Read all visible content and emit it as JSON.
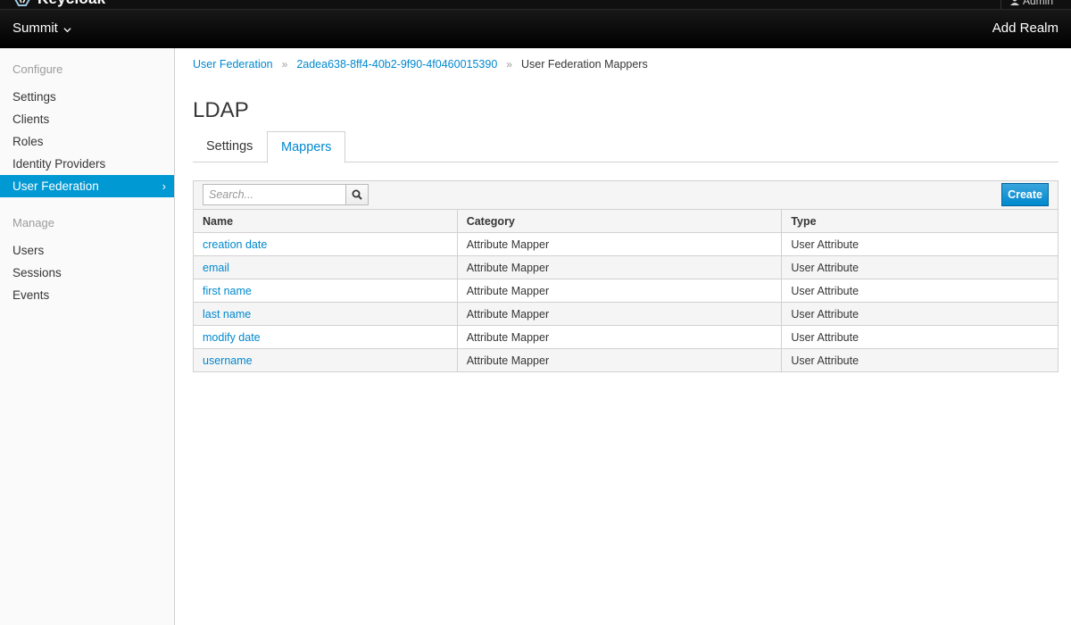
{
  "header": {
    "brand": "Keycloak",
    "user": "Admin",
    "realm": "Summit",
    "add_realm": "Add Realm"
  },
  "sidebar": {
    "configure_heading": "Configure",
    "configure_items": [
      {
        "label": "Settings"
      },
      {
        "label": "Clients"
      },
      {
        "label": "Roles"
      },
      {
        "label": "Identity Providers"
      },
      {
        "label": "User Federation",
        "active": true
      }
    ],
    "manage_heading": "Manage",
    "manage_items": [
      {
        "label": "Users"
      },
      {
        "label": "Sessions"
      },
      {
        "label": "Events"
      }
    ],
    "active_arrow": "›"
  },
  "breadcrumb": {
    "items": [
      "User Federation",
      "2adea638-8ff4-40b2-9f90-4f0460015390"
    ],
    "current": "User Federation Mappers",
    "separator": "»"
  },
  "page": {
    "title": "LDAP",
    "tabs": [
      "Settings",
      "Mappers"
    ],
    "active_tab": "Mappers"
  },
  "toolbar": {
    "search_placeholder": "Search...",
    "create_label": "Create"
  },
  "table": {
    "columns": [
      "Name",
      "Category",
      "Type"
    ],
    "rows": [
      {
        "name": "creation date",
        "category": "Attribute Mapper",
        "type": "User Attribute"
      },
      {
        "name": "email",
        "category": "Attribute Mapper",
        "type": "User Attribute"
      },
      {
        "name": "first name",
        "category": "Attribute Mapper",
        "type": "User Attribute"
      },
      {
        "name": "last name",
        "category": "Attribute Mapper",
        "type": "User Attribute"
      },
      {
        "name": "modify date",
        "category": "Attribute Mapper",
        "type": "User Attribute"
      },
      {
        "name": "username",
        "category": "Attribute Mapper",
        "type": "User Attribute"
      }
    ]
  },
  "colors": {
    "accent": "#0088ce",
    "sidebar_active": "#0099d3",
    "navbar": "#000000"
  },
  "icons": {
    "brand": "keycloak-logo-icon",
    "user": "user-icon",
    "realm_dropdown": "chevron-down-icon",
    "search": "search-icon"
  }
}
